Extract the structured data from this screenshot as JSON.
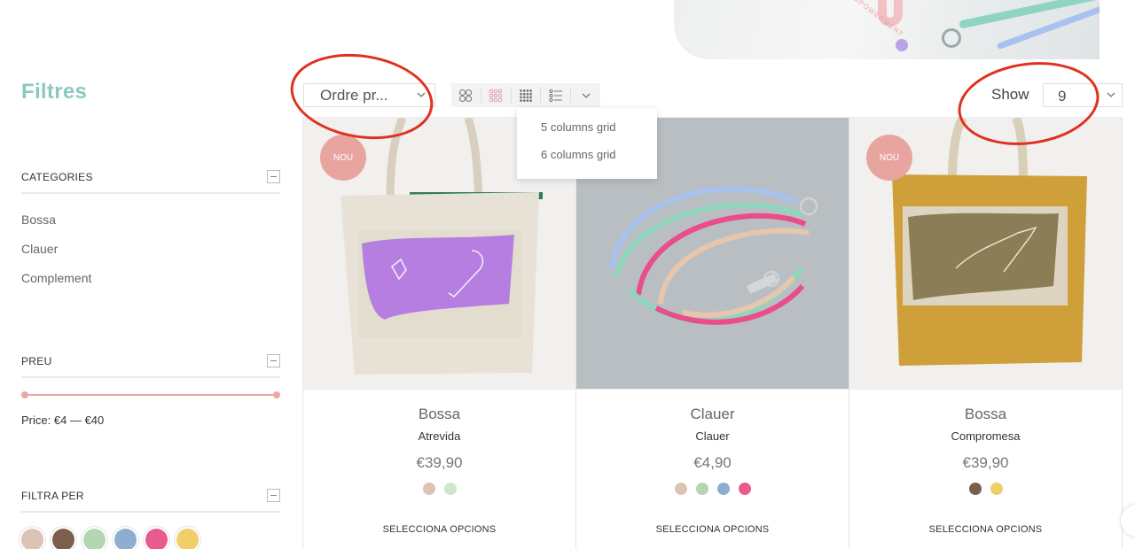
{
  "hero": {
    "mark_text": "EMPOWERMENT"
  },
  "sidebar": {
    "title": "Filtres",
    "categories": {
      "heading": "CATEGORIES",
      "items": [
        "Bossa",
        "Clauer",
        "Complement"
      ]
    },
    "price": {
      "heading": "PREU",
      "label": "Price:",
      "min": "€4",
      "max": "€40",
      "separator": "—"
    },
    "filter_by": {
      "heading": "FILTRA PER",
      "colors": [
        "#dcc3b3",
        "#7b5f4c",
        "#b4d6b2",
        "#8eaed1",
        "#e85b8e",
        "#f0cf69"
      ]
    }
  },
  "toolbar": {
    "orderby_value": "Ordre pr...",
    "view_icons": [
      "grid-2-icon",
      "grid-3-icon",
      "grid-4-icon",
      "list-icon",
      "chevron-down-icon"
    ],
    "dropdown": [
      "5 columns grid",
      "6 columns grid"
    ],
    "show_label": "Show",
    "show_value": "9"
  },
  "products": [
    {
      "badge": "NOU",
      "category": "Bossa",
      "name": "Atrevida",
      "price": "€39,90",
      "colors": [
        "#dcc3b3",
        "#cfe6cc"
      ],
      "cta": "SELECCIONA OPCIONS"
    },
    {
      "badge": "",
      "category": "Clauer",
      "name": "Clauer",
      "price": "€4,90",
      "colors": [
        "#dcc3b3",
        "#b4d6b2",
        "#8eaed1",
        "#e85b8e"
      ],
      "cta": "SELECCIONA OPCIONS"
    },
    {
      "badge": "NOU",
      "category": "Bossa",
      "name": "Compromesa",
      "price": "€39,90",
      "colors": [
        "#7b5f4c",
        "#f0cf69"
      ],
      "cta": "SELECCIONA OPCIONS"
    }
  ],
  "colors": {
    "accent": "#8cc9c0",
    "badge": "#e8a5a0",
    "annotation": "#e0301e"
  }
}
